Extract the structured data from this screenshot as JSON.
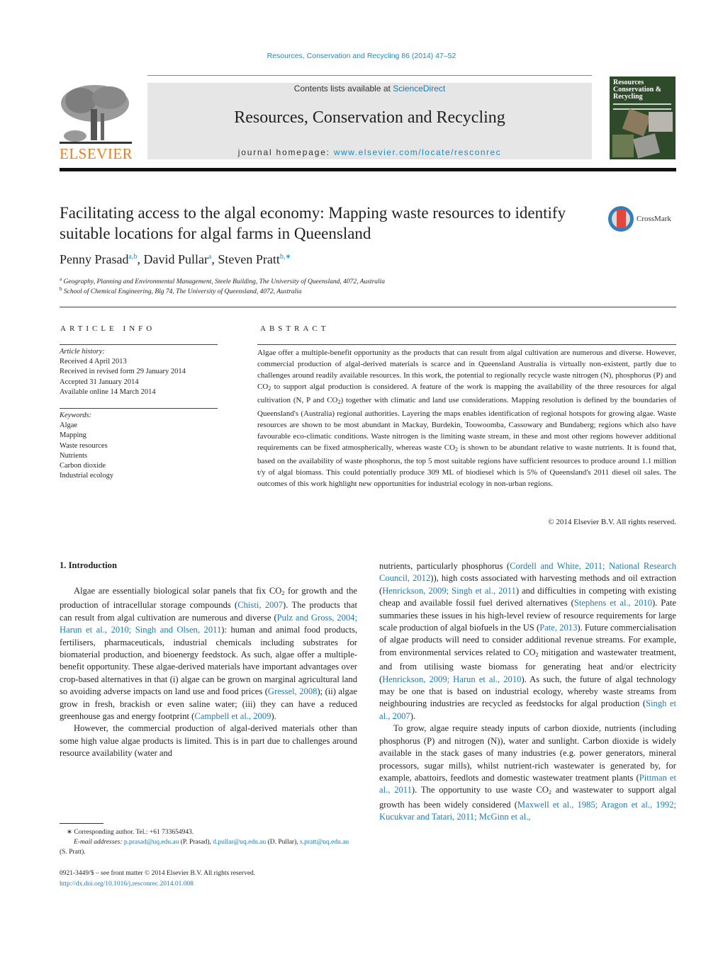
{
  "header": {
    "journal_ref": "Resources, Conservation and Recycling 86 (2014) 47–52",
    "publisher_logo_text": "ELSEVIER",
    "contents_prefix": "Contents lists available at ",
    "contents_link": "ScienceDirect",
    "journal_title": "Resources, Conservation and Recycling",
    "homepage_prefix": "journal homepage: ",
    "homepage_link": "www.elsevier.com/locate/resconrec",
    "cover_title_lines": [
      "Resources",
      "Conservation &",
      "Recycling"
    ]
  },
  "article": {
    "title": "Facilitating access to the algal economy: Mapping waste resources to identify suitable locations for algal farms in Queensland",
    "crossmark_label": "CrossMark",
    "authors": [
      {
        "name": "Penny Prasad",
        "sup": "a,b"
      },
      {
        "name": "David Pullar",
        "sup": "a"
      },
      {
        "name": "Steven Pratt",
        "sup": "b,∗"
      }
    ],
    "affiliations": [
      {
        "mark": "a",
        "text": "Geography, Planning and Environmental Management, Steele Building, The University of Queensland, 4072, Australia"
      },
      {
        "mark": "b",
        "text": "School of Chemical Engineering, Blg 74, The University of Queensland, 4072, Australia"
      }
    ]
  },
  "article_info": {
    "heading": "ARTICLE INFO",
    "history_label": "Article history:",
    "history": [
      "Received 4 April 2013",
      "Received in revised form 29 January 2014",
      "Accepted 31 January 2014",
      "Available online 14 March 2014"
    ],
    "keywords_label": "Keywords:",
    "keywords": [
      "Algae",
      "Mapping",
      "Waste resources",
      "Nutrients",
      "Carbon dioxide",
      "Industrial ecology"
    ]
  },
  "abstract": {
    "heading": "ABSTRACT",
    "parts": [
      "Algae offer a multiple-benefit opportunity as the products that can result from algal cultivation are numerous and diverse. However, commercial production of algal-derived materials is scarce and in Queensland Australia is virtually non-existent, partly due to challenges around readily available resources. In this work, the potential to regionally recycle waste nitrogen (N), phosphorus (P) and CO",
      "2",
      " to support algal production is considered. A feature of the work is mapping the availability of the three resources for algal cultivation (N, P and CO",
      "2",
      ") together with climatic and land use considerations. Mapping resolution is defined by the boundaries of Queensland's (Australia) regional authorities. Layering the maps enables identification of regional hotspots for growing algae. Waste resources are shown to be most abundant in Mackay, Burdekin, Toowoomba, Cassowary and Bundaberg; regions which also have favourable eco-climatic conditions. Waste nitrogen is the limiting waste stream, in these and most other regions however additional requirements can be fixed atmospherically, whereas waste CO",
      "2",
      " is shown to be abundant relative to waste nutrients. It is found that, based on the availability of waste phosphorus, the top 5 most suitable regions have sufficient resources to produce around 1.1 million t/y of algal biomass. This could potentially produce 309 ML of biodiesel which is 5% of Queensland's 2011 diesel oil sales. The outcomes of this work highlight new opportunities for industrial ecology in non-urban regions."
    ],
    "copyright": "© 2014 Elsevier B.V. All rights reserved."
  },
  "introduction": {
    "heading": "1.  Introduction",
    "left": {
      "p1": [
        "Algae are essentially biological solar panels that fix CO",
        "2",
        " for growth and the production of intracellular storage compounds (",
        "Chisti, 2007",
        "). The products that can result from algal cultivation are numerous and diverse (",
        "Pulz and Gross, 2004; Harun et al., 2010; Singh and Olsen, 2011",
        "): human and animal food products, fertilisers, pharmaceuticals, industrial chemicals including substrates for biomaterial production, and bioenergy feedstock. As such, algae offer a multiple-benefit opportunity. These algae-derived materials have important advantages over crop-based alternatives in that (i) algae can be grown on marginal agricultural land so avoiding adverse impacts on land use and food prices (",
        "Gressel, 2008",
        "); (ii) algae grow in fresh, brackish or even saline water; (iii) they can have a reduced greenhouse gas and energy footprint (",
        "Campbell et al., 2009",
        ")."
      ],
      "p2": "However, the commercial production of algal-derived materials other than some high value algae products is limited. This is in part due to challenges around resource availability (water and"
    },
    "right": {
      "p1": [
        "nutrients, particularly phosphorus (",
        "Cordell and White, 2011; National Research Council, 2012",
        ")), high costs associated with harvesting methods and oil extraction (",
        "Henrickson, 2009; Singh et al., 2011",
        ") and difficulties in competing with existing cheap and available fossil fuel derived alternatives (",
        "Stephens et al., 2010",
        "). Pate summaries these issues in his high-level review of resource requirements for large scale production of algal biofuels in the US (",
        "Pate, 2013",
        "). Future commercialisation of algae products will need to consider additional revenue streams. For example, from environmental services related to CO",
        "2",
        " mitigation and wastewater treatment, and from utilising waste biomass for generating heat and/or electricity (",
        "Henrickson, 2009; Harun et al., 2010",
        "). As such, the future of algal technology may be one that is based on industrial ecology, whereby waste streams from neighbouring industries are recycled as feedstocks for algal production (",
        "Singh et al., 2007",
        ")."
      ],
      "p2": [
        "To grow, algae require steady inputs of carbon dioxide, nutrients (including phosphorus (P) and nitrogen (N)), water and sunlight. Carbon dioxide is widely available in the stack gases of many industries (e.g. power generators, mineral processors, sugar mills), whilst nutrient-rich wastewater is generated by, for example, abattoirs, feedlots and domestic wastewater treatment plants (",
        "Pittman et al., 2011",
        "). The opportunity to use waste CO",
        "2",
        " and wastewater to support algal growth has been widely considered (",
        "Maxwell et al., 1985; Aragon et al., 1992; Kucukvar and Tatari, 2011; McGinn et al.,"
      ]
    }
  },
  "footnote": {
    "star": "∗",
    "corresponding": "Corresponding author. Tel.: +61 733654943.",
    "email_label": "E-mail addresses:",
    "emails": [
      {
        "address": "p.prasad@uq.edu.au",
        "name": "(P. Prasad),"
      },
      {
        "address": "d.pullar@uq.edu.au",
        "name": "(D. Pullar),"
      },
      {
        "address": "s.pratt@uq.edu.au",
        "name": "(S. Pratt)."
      }
    ]
  },
  "front_matter": {
    "issn": "0921-3449/$ – see front matter © 2014 Elsevier B.V. All rights reserved.",
    "doi": "http://dx.doi.org/10.1016/j.resconrec.2014.01.008"
  }
}
